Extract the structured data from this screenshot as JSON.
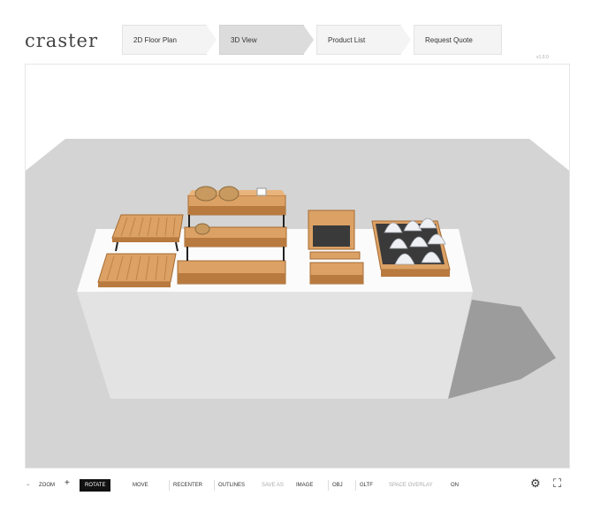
{
  "logo": "craster",
  "steps": [
    {
      "label": "2D Floor Plan"
    },
    {
      "label": "3D View"
    },
    {
      "label": "Product List"
    },
    {
      "label": "Request Quote"
    }
  ],
  "active_step": "3D View",
  "version": "v1.0.0",
  "toolbar": {
    "zoom_out": "−",
    "zoom_label": "ZOOM",
    "zoom_in": "+",
    "rotate": "ROTATE",
    "move": "MOVE",
    "recenter": "RECENTER",
    "outlines": "OUTLINES",
    "save_as": "SAVE AS",
    "image": "IMAGE",
    "obj": "OBJ",
    "gltf": "GLTF",
    "space_overlay": "SPACE OVERLAY",
    "space_overlay_state": "ON",
    "settings_icon": "gear-icon",
    "fullscreen_icon": "expand-icon"
  },
  "colors": {
    "wood": "#dca164",
    "wood_dark": "#b87a3f",
    "floor": "#d4d4d4",
    "table": "#e9e9e9",
    "active_step": "#dcdcdc"
  }
}
